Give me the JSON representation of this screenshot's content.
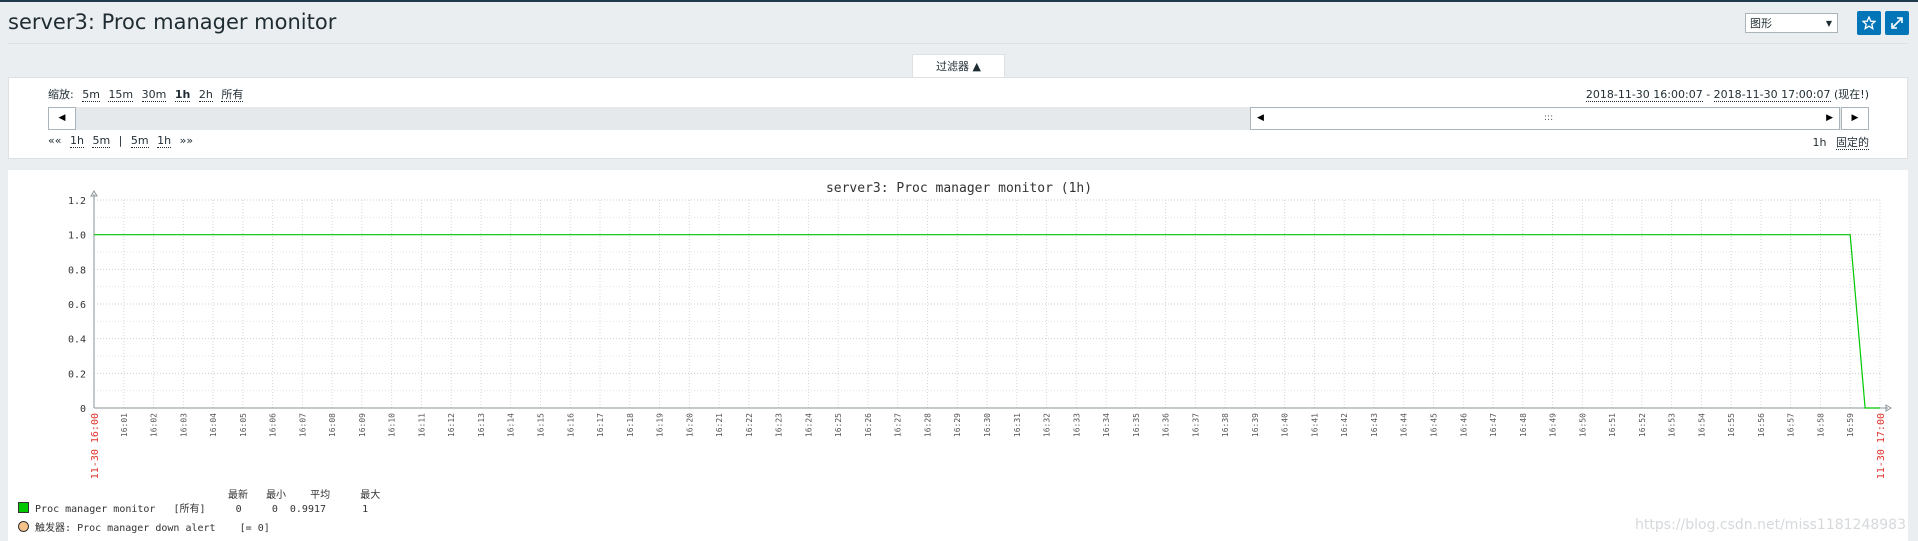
{
  "page": {
    "title": "server3: Proc manager monitor"
  },
  "view_select": {
    "value": "图形"
  },
  "filter_tab": {
    "label": "过滤器 ▲"
  },
  "zoom": {
    "label": "缩放:",
    "options": [
      "5m",
      "15m",
      "30m",
      "1h",
      "2h",
      "所有"
    ],
    "active": "1h"
  },
  "time_range": {
    "from": "2018-11-30 16:00:07",
    "sep": " - ",
    "to": "2018-11-30 17:00:07",
    "now": "(现在!)"
  },
  "nav": {
    "left_arrow": "◀",
    "right_arrow": "▶",
    "grip": ":::"
  },
  "step": {
    "back": "««",
    "items": [
      "1h",
      "5m",
      "|",
      "5m",
      "1h"
    ],
    "forward": "»»"
  },
  "period": {
    "value": "1h",
    "fixed_label": "固定的"
  },
  "graph": {
    "title": "server3: Proc manager monitor (1h)"
  },
  "chart_data": {
    "type": "line",
    "title": "server3: Proc manager monitor (1h)",
    "ylim": [
      0,
      1.2
    ],
    "y_ticks": [
      "0",
      "0.2",
      "0.4",
      "0.6",
      "0.8",
      "1.0",
      "1.2"
    ],
    "x_start_label": "11-30 16:00",
    "x_end_label": "11-30 17:00",
    "x_tick_labels": [
      "16:01",
      "16:02",
      "16:03",
      "16:04",
      "16:05",
      "16:06",
      "16:07",
      "16:08",
      "16:09",
      "16:10",
      "16:11",
      "16:12",
      "16:13",
      "16:14",
      "16:15",
      "16:16",
      "16:17",
      "16:18",
      "16:19",
      "16:20",
      "16:21",
      "16:22",
      "16:23",
      "16:24",
      "16:25",
      "16:26",
      "16:27",
      "16:28",
      "16:29",
      "16:30",
      "16:31",
      "16:32",
      "16:33",
      "16:34",
      "16:35",
      "16:36",
      "16:37",
      "16:38",
      "16:39",
      "16:40",
      "16:41",
      "16:42",
      "16:43",
      "16:44",
      "16:45",
      "16:46",
      "16:47",
      "16:48",
      "16:49",
      "16:50",
      "16:51",
      "16:52",
      "16:53",
      "16:54",
      "16:55",
      "16:56",
      "16:57",
      "16:58",
      "16:59"
    ],
    "series": [
      {
        "name": "Proc manager monitor",
        "color": "#00c800",
        "x": [
          "16:00",
          "16:59",
          "16:59:30",
          "17:00"
        ],
        "values": [
          1,
          1,
          0,
          0
        ]
      }
    ],
    "grid": true
  },
  "legend": {
    "headers": {
      "last": "最新",
      "min": "最小",
      "avg": "平均",
      "max": "最大"
    },
    "series": {
      "name": "Proc manager monitor",
      "scope": "[所有]",
      "last": "0",
      "min": "0",
      "avg": "0.9917",
      "max": "1",
      "color": "#00c800"
    },
    "trigger": {
      "text": "触发器: Proc manager down alert",
      "cond": "[= 0]",
      "color": "#f5c38a"
    }
  },
  "watermark": {
    "text": "https://blog.csdn.net/miss1181248983"
  }
}
